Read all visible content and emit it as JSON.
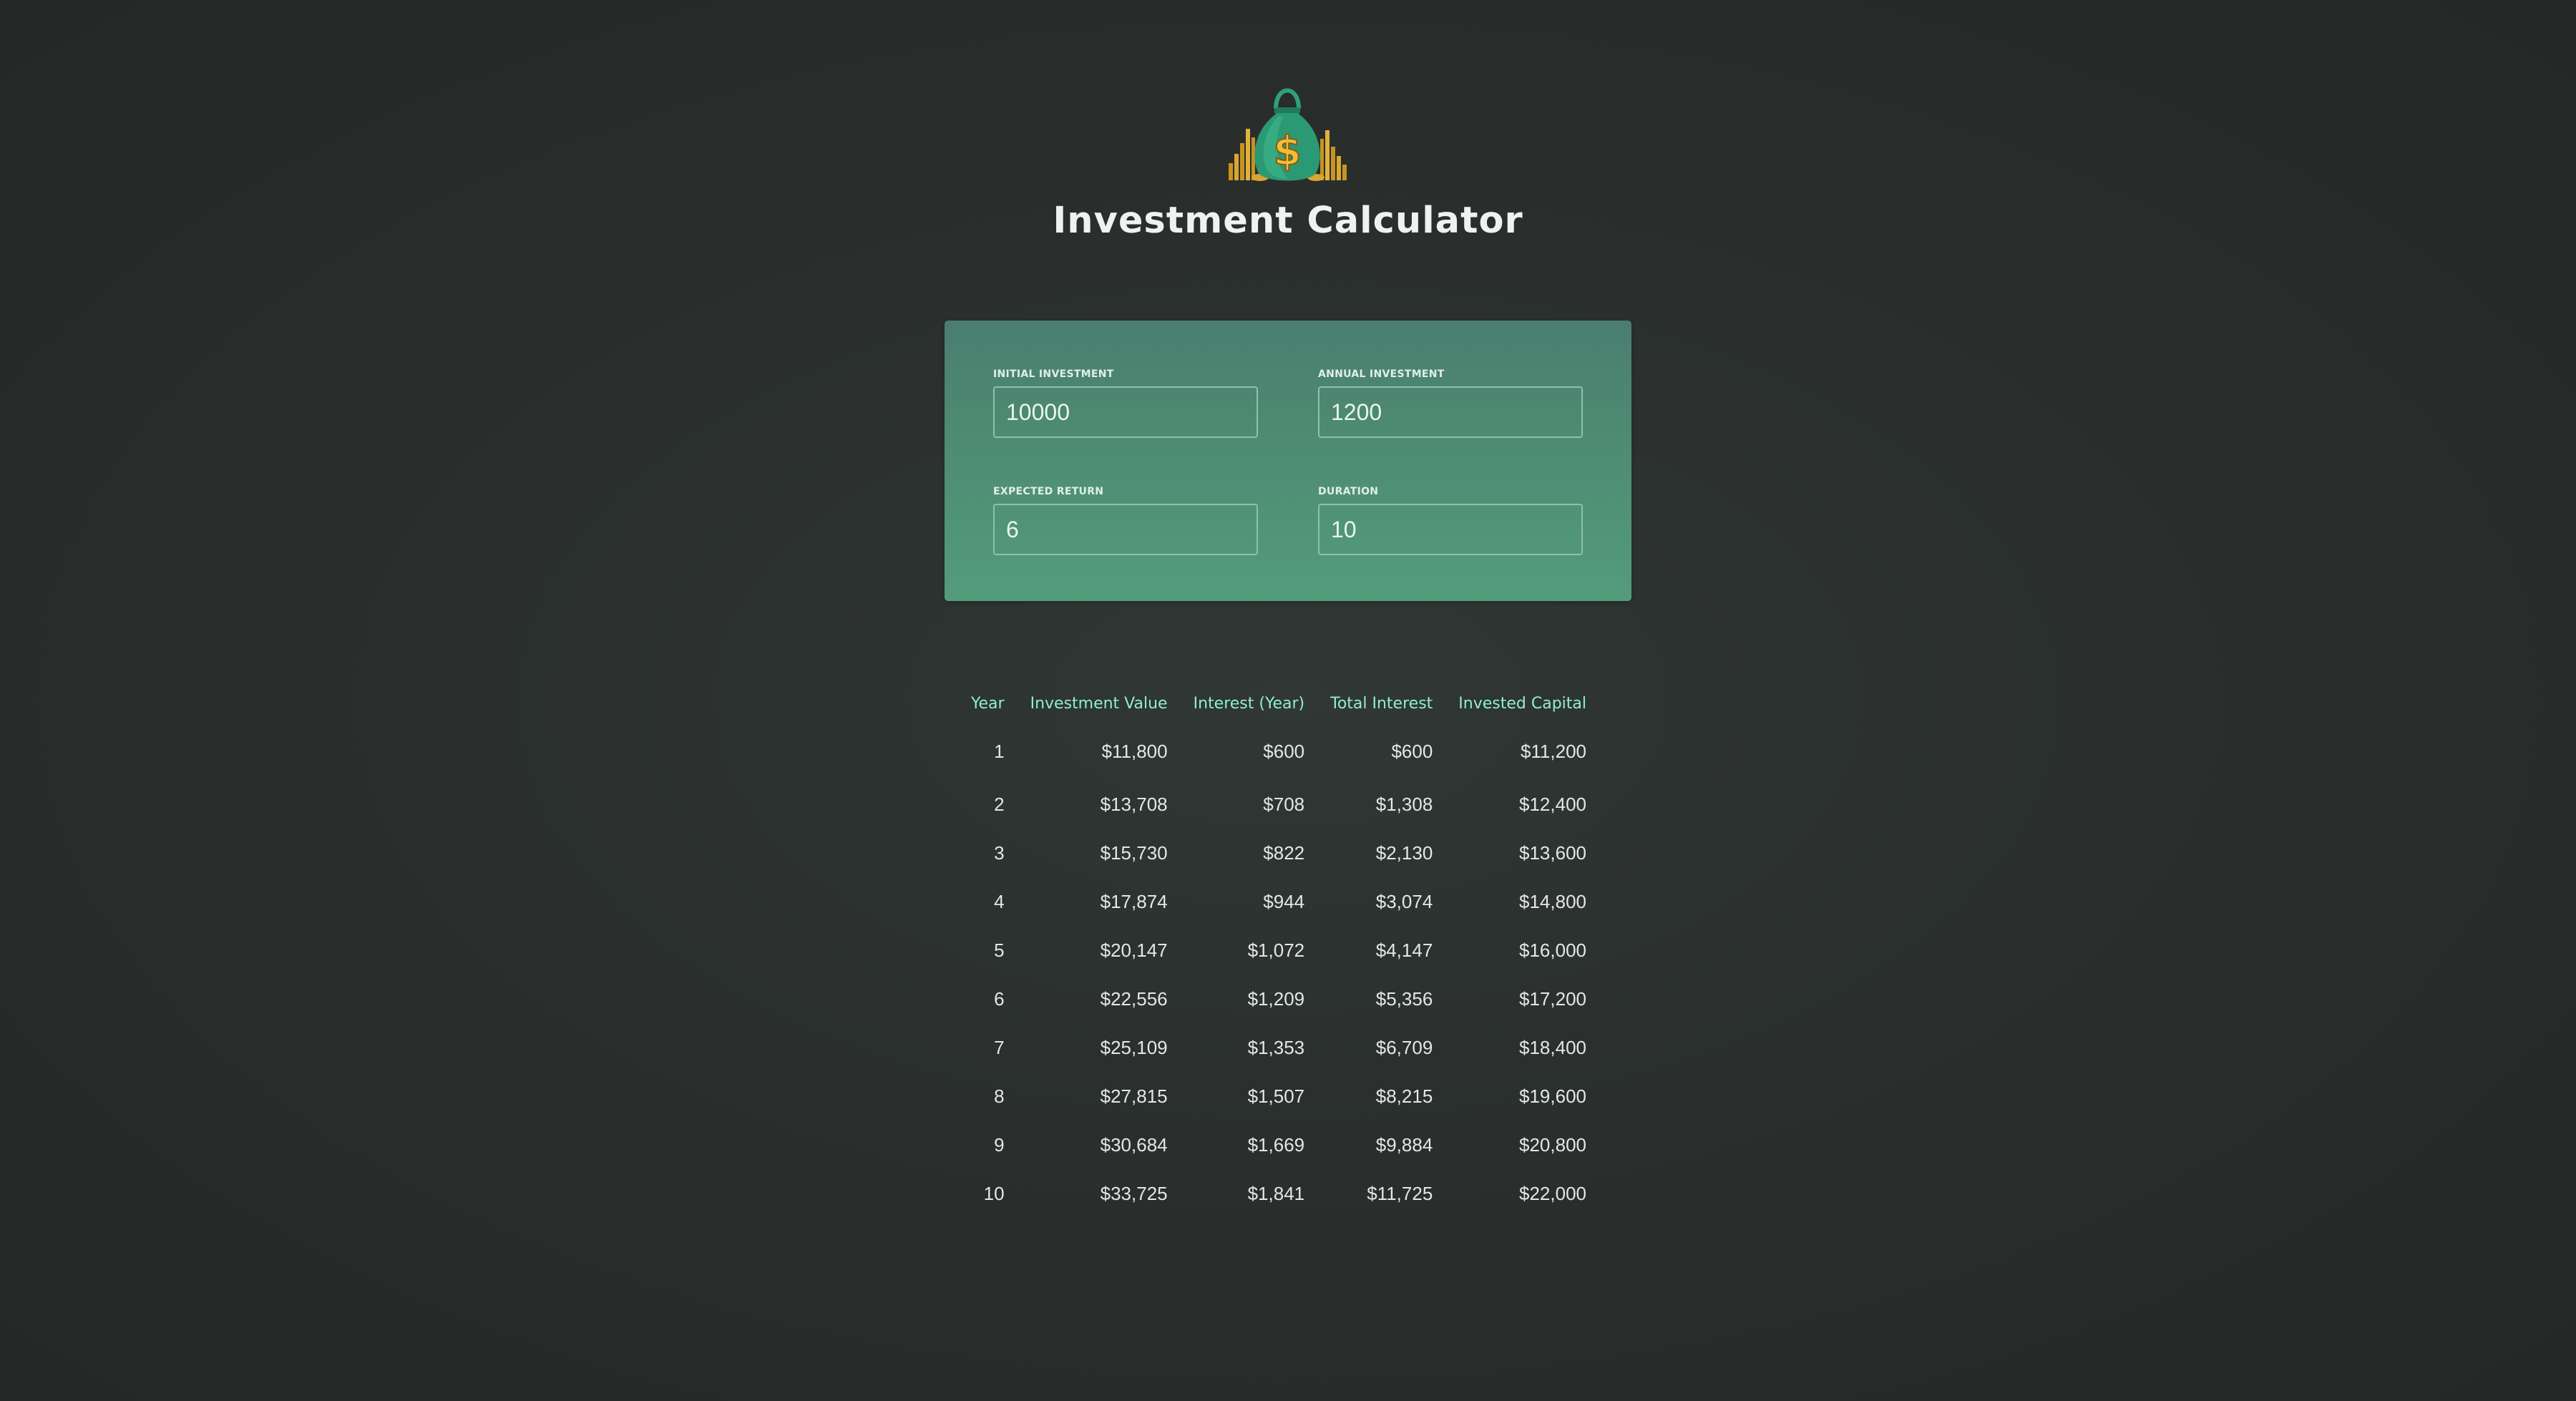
{
  "header": {
    "title": "Investment Calculator",
    "logo_icon": "money-bag-icon"
  },
  "inputs": {
    "initial_investment": {
      "label": "INITIAL INVESTMENT",
      "value": "10000"
    },
    "annual_investment": {
      "label": "ANNUAL INVESTMENT",
      "value": "1200"
    },
    "expected_return": {
      "label": "EXPECTED RETURN",
      "value": "6"
    },
    "duration": {
      "label": "DURATION",
      "value": "10"
    }
  },
  "table": {
    "columns": [
      "Year",
      "Investment Value",
      "Interest (Year)",
      "Total Interest",
      "Invested Capital"
    ],
    "rows": [
      [
        "1",
        "$11,800",
        "$600",
        "$600",
        "$11,200"
      ],
      [
        "2",
        "$13,708",
        "$708",
        "$1,308",
        "$12,400"
      ],
      [
        "3",
        "$15,730",
        "$822",
        "$2,130",
        "$13,600"
      ],
      [
        "4",
        "$17,874",
        "$944",
        "$3,074",
        "$14,800"
      ],
      [
        "5",
        "$20,147",
        "$1,072",
        "$4,147",
        "$16,000"
      ],
      [
        "6",
        "$22,556",
        "$1,209",
        "$5,356",
        "$17,200"
      ],
      [
        "7",
        "$25,109",
        "$1,353",
        "$6,709",
        "$18,400"
      ],
      [
        "8",
        "$27,815",
        "$1,507",
        "$8,215",
        "$19,600"
      ],
      [
        "9",
        "$30,684",
        "$1,669",
        "$9,884",
        "$20,800"
      ],
      [
        "10",
        "$33,725",
        "$1,841",
        "$11,725",
        "$22,000"
      ]
    ]
  },
  "colors": {
    "background": "#2a2f2d",
    "panel": "#4f8f77",
    "header_text": "#8ff0c6",
    "title_text": "#eef3f0",
    "cell_text": "#e3e8e5",
    "logo_gold": "#d9a62f"
  }
}
